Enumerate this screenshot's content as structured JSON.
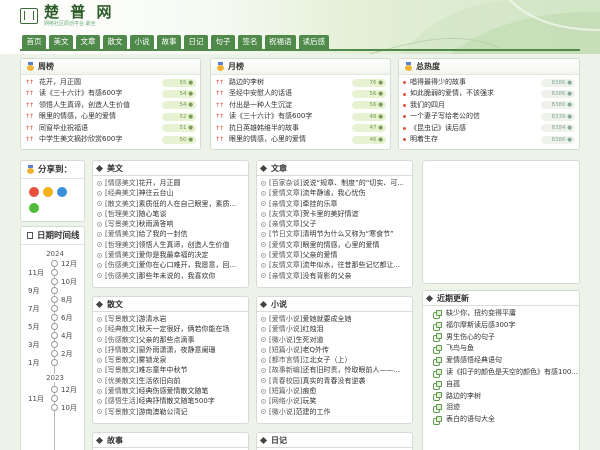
{
  "site": {
    "title": "楚 普 网",
    "subtitle": "网络社区原创平台 最全"
  },
  "nav": [
    "首页",
    "美文",
    "文章",
    "散文",
    "小说",
    "故事",
    "日记",
    "句子",
    "签名",
    "祝福语",
    "读后感"
  ],
  "rank_panels": [
    {
      "title": "周榜",
      "items": [
        {
          "title": "花开，月正圆",
          "hot": "55"
        },
        {
          "title": "读《三十六计》有感600字",
          "hot": "54"
        },
        {
          "title": "领悟人生真谛，创造人生价值",
          "hot": "54"
        },
        {
          "title": "眼里的情感，心里的爱情",
          "hot": "52"
        },
        {
          "title": "同窗毕业祝福语",
          "hot": "51"
        },
        {
          "title": "中学生美文摘抄欣赏600字",
          "hot": "50"
        }
      ]
    },
    {
      "title": "月榜",
      "items": [
        {
          "title": "路边的李树",
          "hot": "76"
        },
        {
          "title": "圣经中安慰人的话语",
          "hot": "56"
        },
        {
          "title": "付出是一种人生沉淀",
          "hot": "56"
        },
        {
          "title": "读《三十六计》有感600字",
          "hot": "48"
        },
        {
          "title": "抗日英雄韩维半的故事",
          "hot": "47"
        },
        {
          "title": "眼里的情感，心里的爱情",
          "hot": "46"
        }
      ]
    },
    {
      "title": "总热度",
      "items": [
        {
          "title": "唱得最得少的故事",
          "hot": "8386"
        },
        {
          "title": "如此脆弱的爱情，不该强求",
          "hot": "8386"
        },
        {
          "title": "我们的四月",
          "hot": "8386"
        },
        {
          "title": "一个妻子写给老公的信",
          "hot": "8339"
        },
        {
          "title": "《昆虫记》读后感",
          "hot": "8384"
        },
        {
          "title": "明着生存",
          "hot": "8386"
        }
      ]
    }
  ],
  "share": {
    "title": "分享到："
  },
  "timeline": {
    "title": "日期时间线",
    "years": [
      "2024",
      "2023"
    ],
    "months_2024": [
      "12月",
      "11月",
      "10月",
      "9月",
      "8月",
      "7月",
      "6月",
      "5月",
      "4月",
      "3月",
      "2月",
      "1月"
    ],
    "months_2023": [
      "12月",
      "11月",
      "10月"
    ]
  },
  "articles": [
    {
      "title": "美文",
      "items": [
        {
          "cat": "[情感美文]",
          "title": "花开，月正圆"
        },
        {
          "cat": "[经典美文]",
          "title": "神往云台山"
        },
        {
          "cat": "[散文美文]",
          "title": "素质低的人在自己眼里，素质..."
        },
        {
          "cat": "[哲理美文]",
          "title": "随心笔谈"
        },
        {
          "cat": "[写景美文]",
          "title": "秋雨滴答响"
        },
        {
          "cat": "[爱情美文]",
          "title": "给了我的一封信"
        },
        {
          "cat": "[哲理美文]",
          "title": "领悟人生真谛，创造人生价值"
        },
        {
          "cat": "[爱情美文]",
          "title": "爱你是我最幸福的决定"
        },
        {
          "cat": "[伤感美文]",
          "title": "爱你在心口难开，我愿意，回..."
        },
        {
          "cat": "[伤感美文]",
          "title": "那些年未说的，我喜欢你"
        }
      ]
    },
    {
      "title": "文章",
      "items": [
        {
          "cat": "[百家杂谈]",
          "title": "说说“规章、制度”的“切实、可..."
        },
        {
          "cat": "[爱情文章]",
          "title": "流年静谧，我心忧伤"
        },
        {
          "cat": "[亲情文章]",
          "title": "牵挂的乐章"
        },
        {
          "cat": "[友情文章]",
          "title": "贺卡里的美好情谊"
        },
        {
          "cat": "[亲情文章]",
          "title": "父子"
        },
        {
          "cat": "[节日文章]",
          "title": "清明节为什么又称为“寒食节”"
        },
        {
          "cat": "[爱情文章]",
          "title": "眼里的情感，心里的爱情"
        },
        {
          "cat": "[爱情文章]",
          "title": "父亲的爱情"
        },
        {
          "cat": "[友情文章]",
          "title": "流年似水，往昔那些记忆都让..."
        },
        {
          "cat": "[亲情文章]",
          "title": "没有背影的父亲"
        }
      ]
    },
    {
      "title": "散文",
      "items": [
        {
          "cat": "[写景散文]",
          "title": "游清水岩"
        },
        {
          "cat": "[经典散文]",
          "title": "秋天一定很好，俩若你能在场"
        },
        {
          "cat": "[伤感散文]",
          "title": "父亲的那些点滴事"
        },
        {
          "cat": "[抒情散文]",
          "title": "窗外雨潇潇，夜静意阑珊"
        },
        {
          "cat": "[写景散文]",
          "title": "雾锁龙泉"
        },
        {
          "cat": "[写景散文]",
          "title": "难忘童年中秋节"
        },
        {
          "cat": "[优美散文]",
          "title": "生活依旧向前"
        },
        {
          "cat": "[爱情散文]",
          "title": "经典伤感爱情散文随笔"
        },
        {
          "cat": "[感悟生活]",
          "title": "经典抒情散文随笔500字"
        },
        {
          "cat": "[写景散文]",
          "title": "游南澳勒公湾记"
        }
      ]
    },
    {
      "title": "小说",
      "items": [
        {
          "cat": "[爱情小说]",
          "title": "爱她就要成全她"
        },
        {
          "cat": "[爱情小说]",
          "title": "红烛泪"
        },
        {
          "cat": "[微小说]",
          "title": "生死对道"
        },
        {
          "cat": "[短篇小说]",
          "title": "老Q外传"
        },
        {
          "cat": "[都市言情]",
          "title": "江北女子（上）"
        },
        {
          "cat": "[故事新编]",
          "title": "还有旧时责，怜取眼前人——..."
        },
        {
          "cat": "[青春校园]",
          "title": "真实的青春没有逆袭"
        },
        {
          "cat": "[短篇小说]",
          "title": "痕愈"
        },
        {
          "cat": "[网络小说]",
          "title": "玩笑"
        },
        {
          "cat": "[微小说]",
          "title": "范建的工作"
        }
      ]
    }
  ],
  "bottom_boxes": [
    "故事",
    "日记"
  ],
  "recent": {
    "title": "近期更新",
    "items": [
      "缺少你，扭约变得平庸",
      "福尔摩斯读后感300字",
      "男生伤心的句子",
      "飞鸟与鱼",
      "爱情感悟经典语句",
      "读《扣子的颜色是天空的颜色》有感100...",
      "自孤",
      "路边的李树",
      "泪迹",
      "表白的语句大全"
    ]
  }
}
